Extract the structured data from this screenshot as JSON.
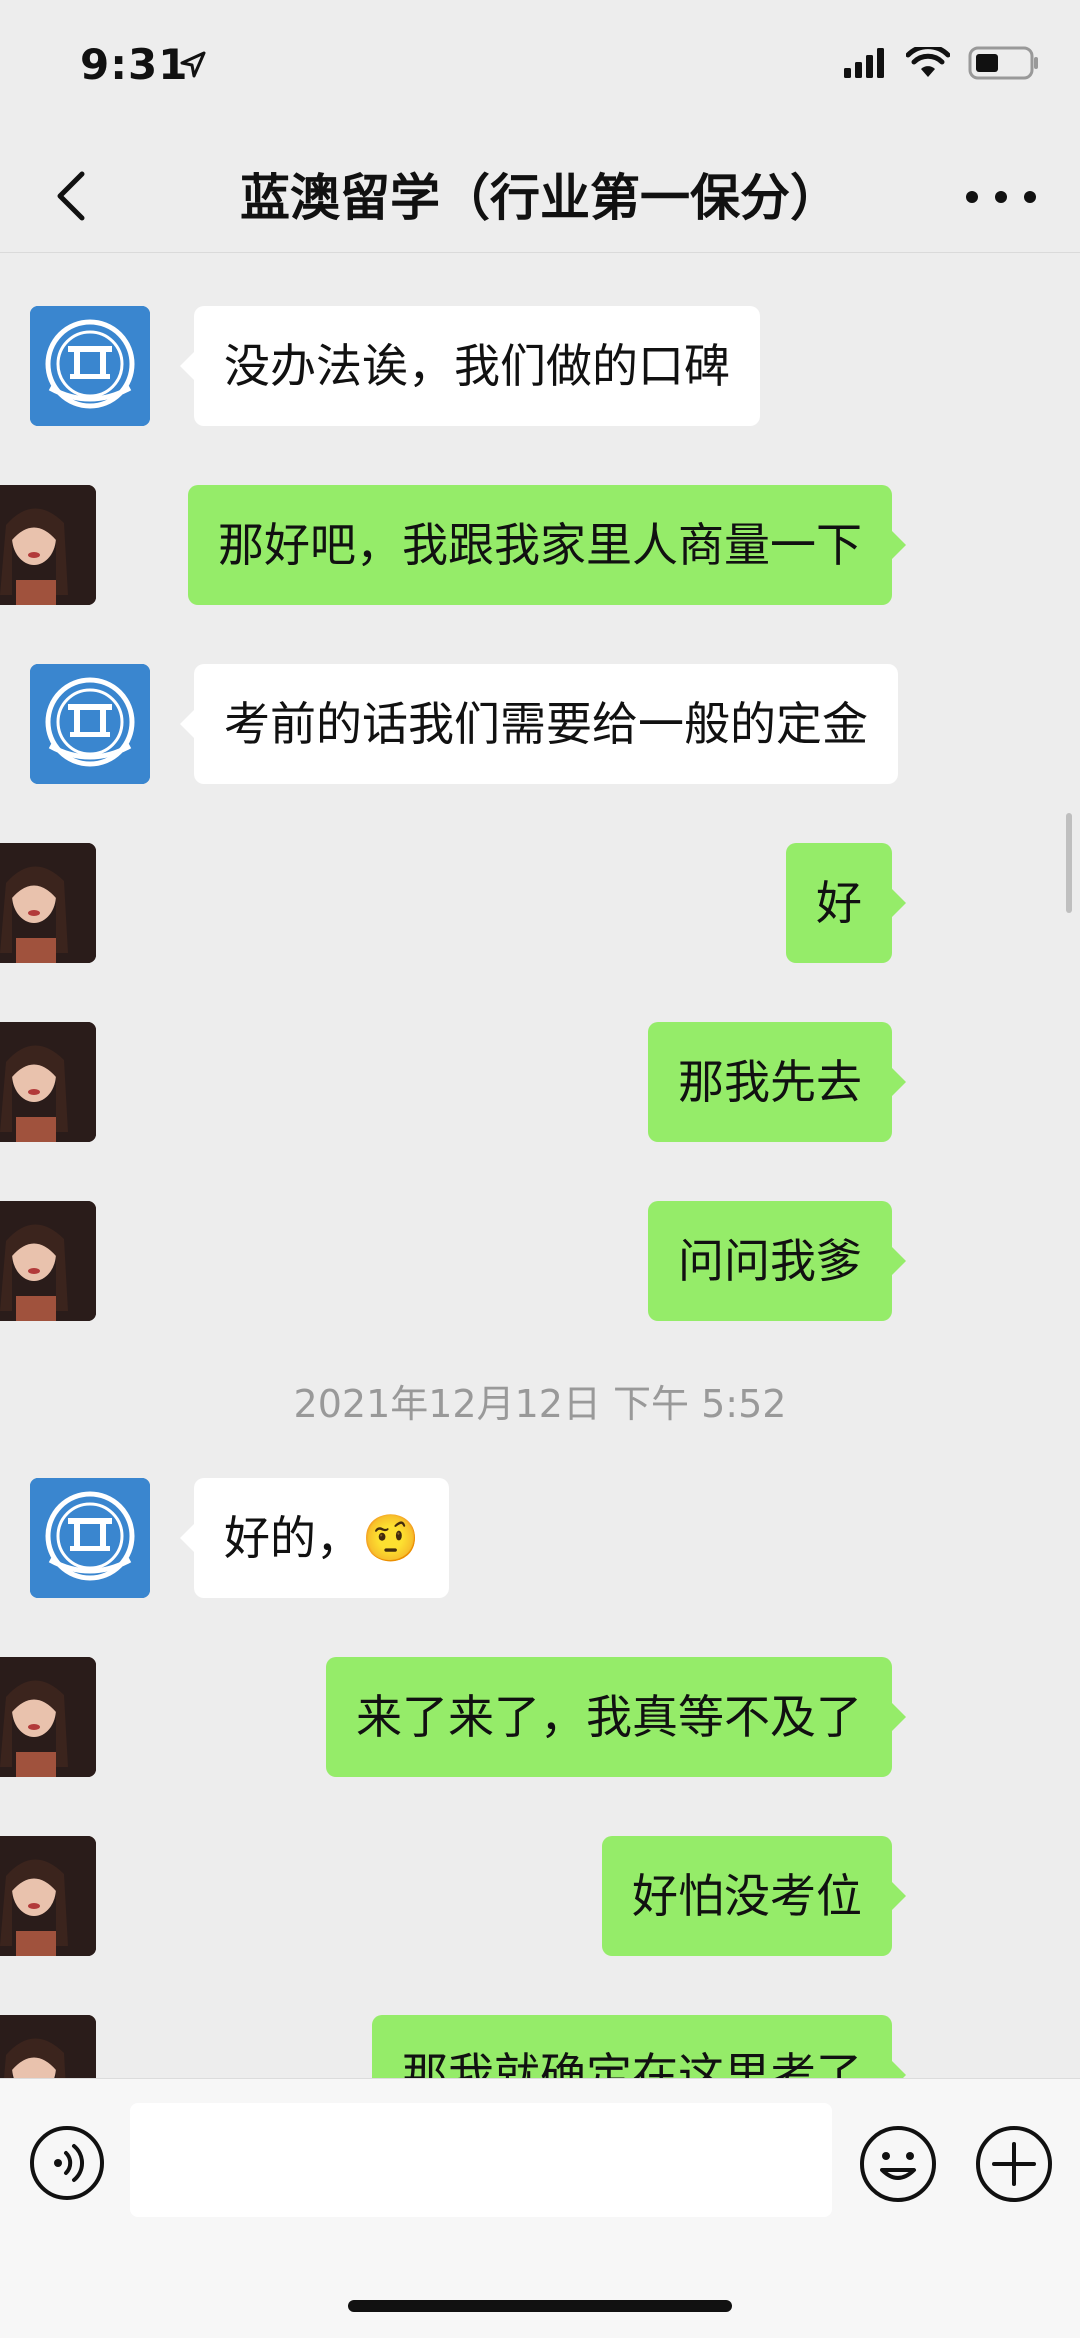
{
  "status_bar": {
    "time": "9:31",
    "icons": [
      "location-arrow-icon",
      "signal-icon",
      "wifi-icon",
      "battery-icon"
    ]
  },
  "header": {
    "title": "蓝澳留学（行业第一保分）",
    "back_icon": "chevron-left-icon",
    "more_icon": "more-dots-icon"
  },
  "messages": [
    {
      "side": "in",
      "text": "没办法诶，我们做的口碑"
    },
    {
      "side": "out",
      "text": "那好吧，我跟我家里人商量一下"
    },
    {
      "side": "in",
      "text": "考前的话我们需要给一般的定金"
    },
    {
      "side": "out",
      "text": "好"
    },
    {
      "side": "out",
      "text": "那我先去"
    },
    {
      "side": "out",
      "text": "问问我爹"
    },
    {
      "side": "in",
      "text": "好的，",
      "emoji": "🤨"
    },
    {
      "side": "out",
      "text": "来了来了，我真等不及了"
    },
    {
      "side": "out",
      "text": "好怕没考位"
    },
    {
      "side": "out",
      "text": "那我就确定在这里考了"
    }
  ],
  "timestamp": "2021年12月12日 下午 5:52",
  "input_bar": {
    "value": "",
    "voice_icon": "voice-icon",
    "emoji_icon": "emoji-icon",
    "plus_icon": "plus-icon"
  },
  "colors": {
    "outgoing_bubble": "#95ec69",
    "incoming_bubble": "#ffffff",
    "background": "#ededed",
    "logo_blue": "#3a86cf"
  }
}
